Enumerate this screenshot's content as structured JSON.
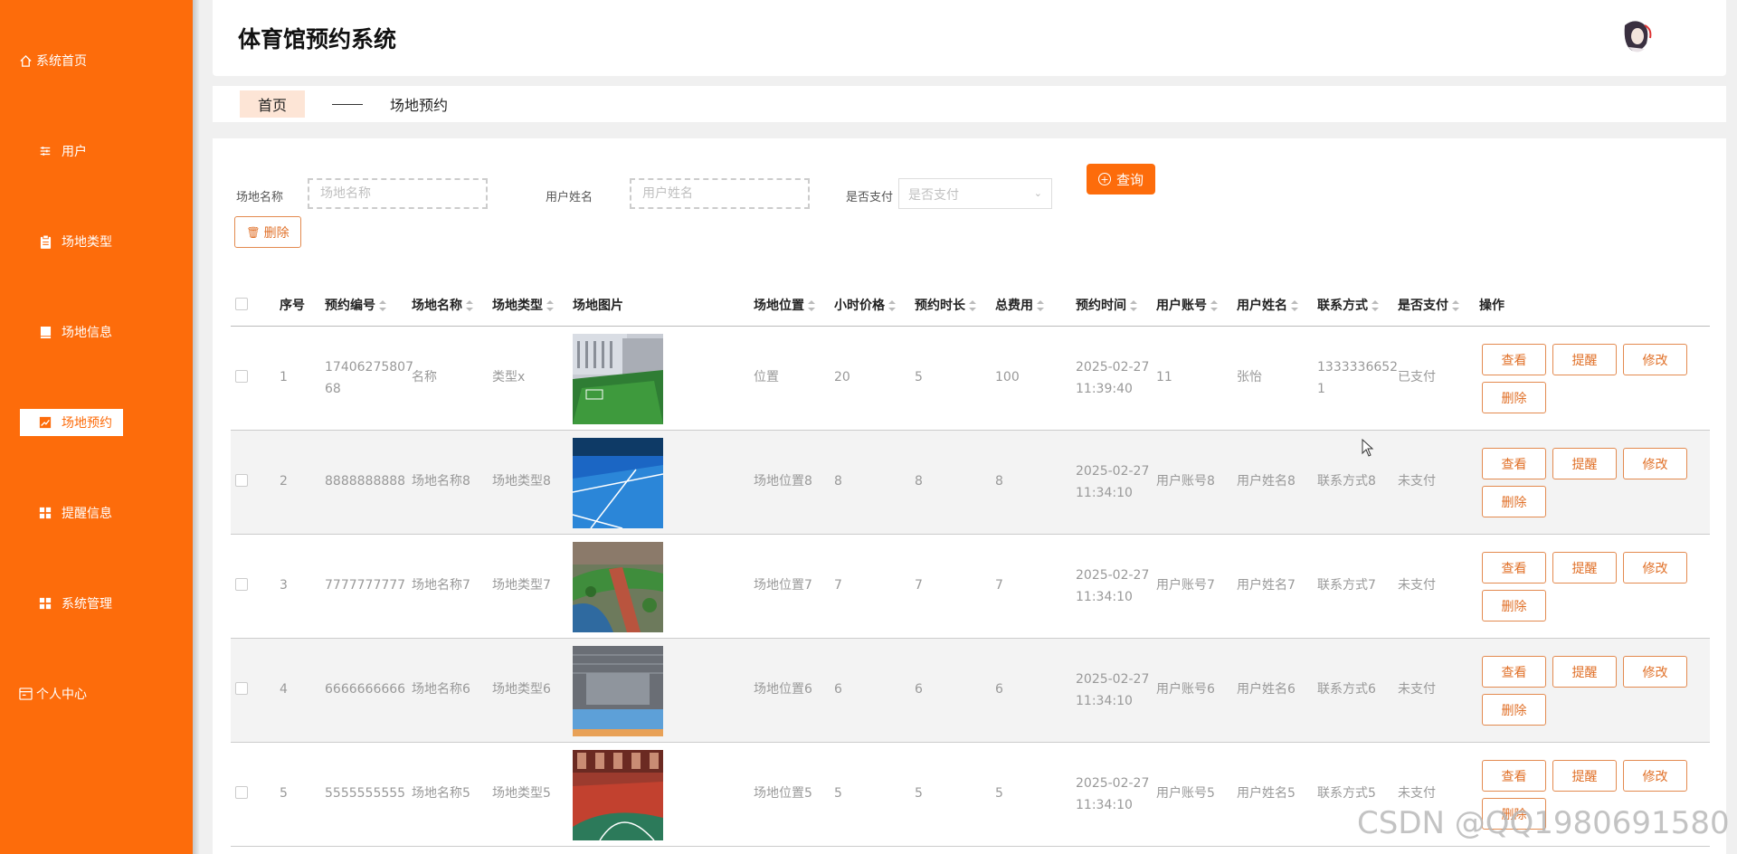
{
  "app": {
    "title": "体育馆预约系统"
  },
  "sidebar": {
    "items": [
      {
        "label": "系统首页",
        "icon": "home-icon"
      },
      {
        "label": "用户",
        "icon": "sliders-icon"
      },
      {
        "label": "场地类型",
        "icon": "clipboard-icon"
      },
      {
        "label": "场地信息",
        "icon": "book-icon"
      },
      {
        "label": "场地预约",
        "icon": "chart-icon",
        "active": true
      },
      {
        "label": "提醒信息",
        "icon": "grid-icon"
      },
      {
        "label": "系统管理",
        "icon": "grid-icon"
      },
      {
        "label": "个人中心",
        "icon": "card-icon"
      }
    ],
    "accent": "#fd6c0b"
  },
  "breadcrumb": {
    "home": "首页",
    "current": "场地预约"
  },
  "search": {
    "venue_name_label": "场地名称",
    "venue_name_placeholder": "场地名称",
    "user_name_label": "用户姓名",
    "user_name_placeholder": "用户姓名",
    "paid_label": "是否支付",
    "paid_placeholder": "是否支付",
    "query_label": "查询",
    "delete_label": "删除"
  },
  "table": {
    "headers": {
      "index": "序号",
      "booking_no": "预约编号",
      "venue_name": "场地名称",
      "venue_type": "场地类型",
      "venue_image": "场地图片",
      "venue_location": "场地位置",
      "hour_price": "小时价格",
      "duration": "预约时长",
      "total": "总费用",
      "booking_time": "预约时间",
      "user_account": "用户账号",
      "user_name": "用户姓名",
      "contact": "联系方式",
      "paid": "是否支付",
      "actions": "操作"
    },
    "action_labels": {
      "view": "查看",
      "remind": "提醒",
      "edit": "修改",
      "delete": "删除"
    },
    "rows": [
      {
        "index": "1",
        "booking_no_1": "17406275807",
        "booking_no_2": "68",
        "venue_name": "名称",
        "venue_type": "类型x",
        "image": "football-field",
        "location": "位置",
        "price": "20",
        "duration": "5",
        "total": "100",
        "date": "2025-02-27",
        "time": "11:39:40",
        "account": "11",
        "user_name": "张怡",
        "contact_1": "1333336652",
        "contact_2": "1",
        "paid": "已支付"
      },
      {
        "index": "2",
        "booking_no_1": "8888888888",
        "booking_no_2": "",
        "venue_name": "场地名称8",
        "venue_type": "场地类型8",
        "image": "tennis-court",
        "location": "场地位置8",
        "price": "8",
        "duration": "8",
        "total": "8",
        "date": "2025-02-27",
        "time": "11:34:10",
        "account": "用户账号8",
        "user_name": "用户姓名8",
        "contact_1": "联系方式8",
        "contact_2": "",
        "paid": "未支付"
      },
      {
        "index": "3",
        "booking_no_1": "7777777777",
        "booking_no_2": "",
        "venue_name": "场地名称7",
        "venue_type": "场地类型7",
        "image": "outdoor-track",
        "location": "场地位置7",
        "price": "7",
        "duration": "7",
        "total": "7",
        "date": "2025-02-27",
        "time": "11:34:10",
        "account": "用户账号7",
        "user_name": "用户姓名7",
        "contact_1": "联系方式7",
        "contact_2": "",
        "paid": "未支付"
      },
      {
        "index": "4",
        "booking_no_1": "6666666666",
        "booking_no_2": "",
        "venue_name": "场地名称6",
        "venue_type": "场地类型6",
        "image": "indoor-gym",
        "location": "场地位置6",
        "price": "6",
        "duration": "6",
        "total": "6",
        "date": "2025-02-27",
        "time": "11:34:10",
        "account": "用户账号6",
        "user_name": "用户姓名6",
        "contact_1": "联系方式6",
        "contact_2": "",
        "paid": "未支付"
      },
      {
        "index": "5",
        "booking_no_1": "5555555555",
        "booking_no_2": "",
        "venue_name": "场地名称5",
        "venue_type": "场地类型5",
        "image": "basketball-court",
        "location": "场地位置5",
        "price": "5",
        "duration": "5",
        "total": "5",
        "date": "2025-02-27",
        "time": "11:34:10",
        "account": "用户账号5",
        "user_name": "用户姓名5",
        "contact_1": "联系方式5",
        "contact_2": "",
        "paid": "未支付"
      }
    ]
  },
  "watermark": "CSDN @QQ1980691580"
}
